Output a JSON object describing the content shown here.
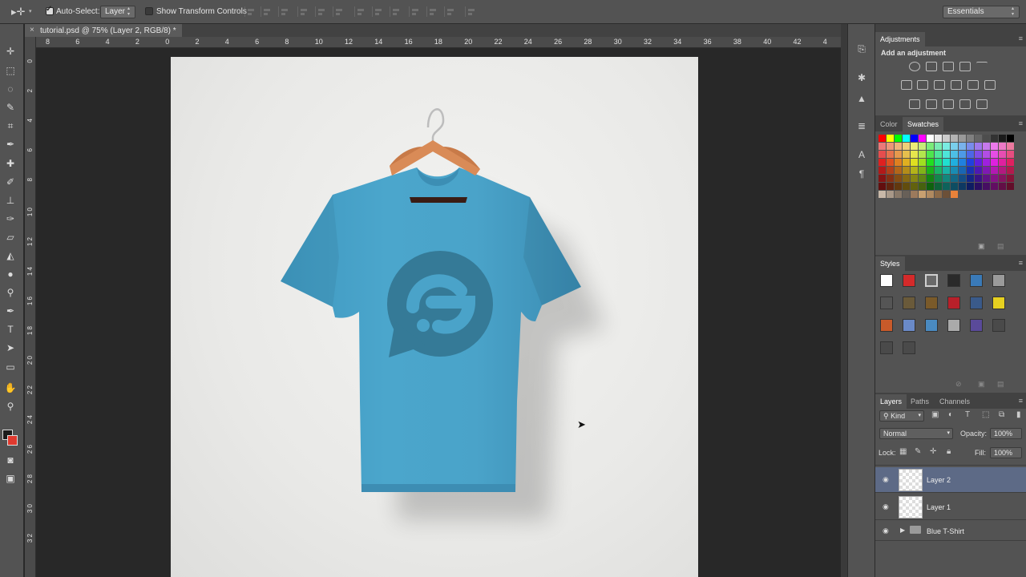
{
  "options_bar": {
    "auto_select_label": "Auto-Select:",
    "auto_select_value": "Layer",
    "show_transform_label": "Show Transform Controls",
    "workspace": "Essentials"
  },
  "document": {
    "tab_title": "tutorial.psd @ 75% (Layer 2, RGB/8) *",
    "close_glyph": "×"
  },
  "rulers": {
    "top": [
      "8",
      "6",
      "4",
      "2",
      "0",
      "2",
      "4",
      "6",
      "8",
      "10",
      "12",
      "14",
      "16",
      "18",
      "20",
      "22",
      "24",
      "26",
      "28",
      "30",
      "32",
      "34",
      "36",
      "38",
      "40",
      "42",
      "4"
    ],
    "left": [
      "0",
      "2",
      "4",
      "6",
      "8",
      "1 0",
      "1 2",
      "1 4",
      "1 6",
      "1 8",
      "2 0",
      "2 2",
      "2 4",
      "2 6",
      "2 8",
      "3 0",
      "3 2"
    ]
  },
  "panels": {
    "adjustments": {
      "title": "Adjustments",
      "subtitle": "Add an adjustment"
    },
    "color_tabs": [
      "Color",
      "Swatches"
    ],
    "styles_title": "Styles",
    "layers_tabs": [
      "Layers",
      "Paths",
      "Channels"
    ],
    "kind_label": "Kind",
    "blend_mode": "Normal",
    "opacity_label": "Opacity:",
    "opacity_value": "100%",
    "lock_label": "Lock:",
    "fill_label": "Fill:",
    "fill_value": "100%",
    "layers": [
      {
        "name": "Layer 2",
        "selected": true
      },
      {
        "name": "Layer 1",
        "selected": false
      },
      {
        "name": "Blue T-Shirt",
        "selected": false,
        "group": true
      }
    ]
  },
  "colors": {
    "shirt": "#4aa3c9",
    "shirt_shade": "#3d8db3",
    "logo": "#357a97",
    "selection": "#5d6a86",
    "foreground": "#1b1b1b",
    "background": "#e03a2f"
  }
}
